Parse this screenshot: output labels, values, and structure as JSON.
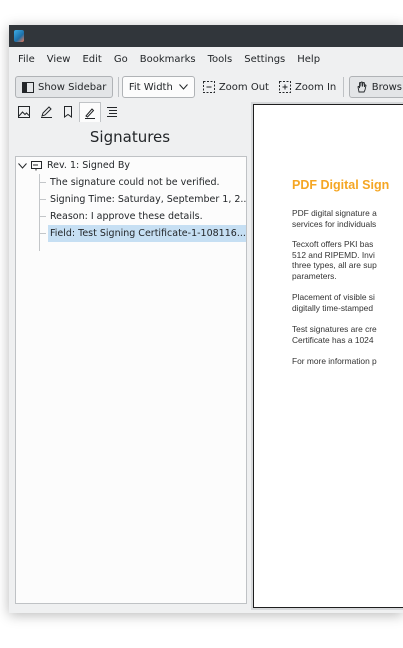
{
  "menu": [
    "File",
    "View",
    "Edit",
    "Go",
    "Bookmarks",
    "Tools",
    "Settings",
    "Help"
  ],
  "toolbar": {
    "show_sidebar": "Show Sidebar",
    "zoom_mode": "Fit Width",
    "zoom_out": "Zoom Out",
    "zoom_in": "Zoom In",
    "browse": "Brows"
  },
  "sidebar": {
    "title": "Signatures",
    "tree": {
      "root": "Rev. 1: Signed By",
      "children": [
        "The signature could not be verified.",
        "Signing Time: Saturday, September 1, 2...",
        "Reason: I approve these details.",
        "Field: Test Signing Certificate-1-108116..."
      ],
      "selected_index": 3
    }
  },
  "document": {
    "title": "PDF Digital Sign",
    "paragraphs": [
      [
        "PDF digital signature a",
        "services for individuals"
      ],
      [
        "Tecxoft offers PKI bas",
        "512 and RIPEMD. Invi",
        "three types, all are sup",
        "parameters."
      ],
      [
        "Placement of visible si",
        "digitally time-stamped"
      ],
      [
        "Test signatures are cre",
        "Certificate has a 1024"
      ],
      [
        "For more information p"
      ]
    ]
  },
  "colors": {
    "accent_title": "#f5a623",
    "selection": "#c6dff3",
    "titlebar": "#31363b"
  }
}
